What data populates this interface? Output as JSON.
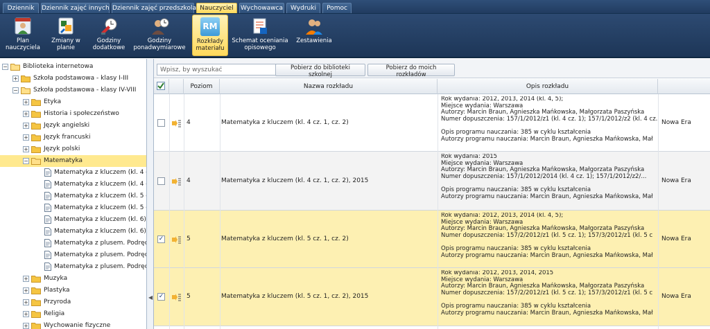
{
  "tabs": [
    {
      "label": "Dziennik"
    },
    {
      "label": "Dziennik zajęć innych"
    },
    {
      "label": "Dziennik zajęć przedszkola"
    },
    {
      "label": "Nauczyciel",
      "active": true
    },
    {
      "label": "Wychowawca"
    },
    {
      "label": "Wydruki"
    },
    {
      "label": "Pomoc"
    }
  ],
  "ribbon": [
    {
      "l1": "Plan",
      "l2": "nauczyciela",
      "icon": "teacher-plan-icon"
    },
    {
      "l1": "Zmiany w",
      "l2": "planie",
      "icon": "plan-changes-icon"
    },
    {
      "l1": "Godziny",
      "l2": "dodatkowe",
      "icon": "extra-hours-icon"
    },
    {
      "l1": "Godziny",
      "l2": "ponadwymiarowe",
      "icon": "overtime-hours-icon"
    },
    {
      "l1": "Rozkłady",
      "l2": "materiału",
      "icon": "rm-icon",
      "badge": "RM",
      "active": true
    },
    {
      "l1": "Schemat oceniania",
      "l2": "opisowego",
      "icon": "grading-scheme-icon"
    },
    {
      "l1": "Zestawienia",
      "l2": "",
      "icon": "reports-icon"
    }
  ],
  "tree": {
    "root": "Biblioteka internetowa",
    "school1": "Szkoła podstawowa - klasy I-III",
    "school2": "Szkoła podstawowa - klasy IV-VIII",
    "subjects_before": [
      "Etyka",
      "Historia i społeczeństwo",
      "Język angielski",
      "Język francuski",
      "Język polski"
    ],
    "selected_subject": "Matematyka",
    "docs": [
      "Matematyka z kluczem (kl. 4 c...",
      "Matematyka z kluczem (kl. 4 c...",
      "Matematyka z kluczem (kl. 5 c...",
      "Matematyka z kluczem (kl. 5 c...",
      "Matematyka z kluczem (kl. 6)",
      "Matematyka z kluczem (kl. 6), ...",
      "Matematyka z plusem. Podręc...",
      "Matematyka z plusem. Podręc...",
      "Matematyka z plusem. Podręc..."
    ],
    "subjects_after": [
      "Muzyka",
      "Plastyka",
      "Przyroda",
      "Religia",
      "Wychowanie fizyczne"
    ]
  },
  "toolbar": {
    "search_placeholder": "Wpisz, by wyszukać",
    "btn_school": "Pobierz do biblioteki szkolnej",
    "btn_mine": "Pobierz do moich rozkładów"
  },
  "grid": {
    "headers": {
      "level": "Poziom",
      "name": "Nazwa rozkładu",
      "desc": "Opis rozkładu"
    },
    "rows": [
      {
        "checked": false,
        "style": "white",
        "level": "4",
        "name": "Matematyka z kluczem (kl. 4 cz. 1, cz. 2)",
        "desc": [
          "Rok wydania: 2012, 2013, 2014 (kl. 4, 5);",
          "Miejsce wydania: Warszawa",
          "Autorzy: Marcin Braun, Agnieszka Mańkowska, Małgorzata Paszyńska",
          "Numer dopuszczenia: 157/1/2012/z1 (kl. 4 cz. 1); 157/1/2012/z2 (kl. 4 cz.",
          "",
          "Opis programu nauczania: 385 w cyklu kształcenia",
          "Autorzy programu nauczania: Marcin Braun, Agnieszka Mańkowska, Mał"
        ],
        "publisher": "Nowa Era"
      },
      {
        "checked": false,
        "style": "alt",
        "level": "4",
        "name": "Matematyka z kluczem (kl. 4 cz. 1, cz. 2), 2015",
        "desc": [
          "Rok wydania: 2015",
          "Miejsce wydania: Warszawa",
          "Autorzy: Marcin Braun, Agnieszka Mańkowska, Małgorzata Paszyńska",
          "Numer dopuszczenia: 157/1/2012/2014 (kl. 4 cz. 1); 157/1/2012/z2/...",
          "",
          "Opis programu nauczania: 385 w cyklu kształcenia",
          "Autorzy programu nauczania: Marcin Braun, Agnieszka Mańkowska, Mał"
        ],
        "publisher": "Nowa Era"
      },
      {
        "checked": true,
        "style": "sel",
        "level": "5",
        "name": "Matematyka z kluczem (kl. 5 cz. 1, cz. 2)",
        "desc": [
          "Rok wydania: 2012, 2013, 2014 (kl. 4, 5);",
          "Miejsce wydania: Warszawa",
          "Autorzy: Marcin Braun, Agnieszka Mańkowska, Małgorzata Paszyńska",
          "Numer dopuszczenia: 157/2/2012/z1 (kl. 5 cz. 1); 157/3/2012/z1 (kl. 5 c",
          "",
          "Opis programu nauczania: 385 w cyklu kształcenia",
          "Autorzy programu nauczania: Marcin Braun, Agnieszka Mańkowska, Mał"
        ],
        "publisher": "Nowa Era"
      },
      {
        "checked": true,
        "style": "sel",
        "level": "5",
        "name": "Matematyka z kluczem (kl. 5 cz. 1, cz. 2), 2015",
        "desc": [
          "Rok wydania: 2012, 2013, 2014, 2015",
          "Miejsce wydania: Warszawa",
          "Autorzy: Marcin Braun, Agnieszka Mańkowska, Małgorzata Paszyńska",
          "Numer dopuszczenia: 157/2/2012/z1 (kl. 5 cz. 1); 157/3/2012/z1 (kl. 5 c",
          "",
          "Opis programu nauczania: 385 w cyklu kształcenia",
          "Autorzy programu nauczania: Marcin Braun, Agnieszka Mańkowska, Mał"
        ],
        "publisher": "Nowa Era"
      }
    ]
  },
  "colors": {
    "accent": "#ffd95a",
    "header_bg": "#2d4a72",
    "selected_row": "#fdf0b2"
  }
}
